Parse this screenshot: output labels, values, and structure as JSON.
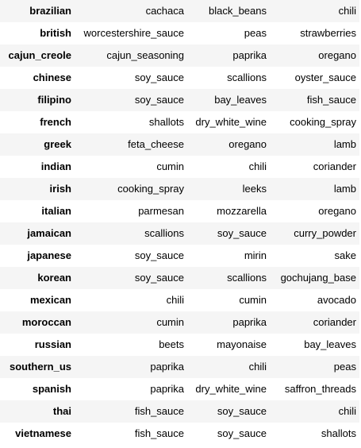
{
  "rows": [
    {
      "cuisine": "brazilian",
      "ingredients": [
        "cachaca",
        "black_beans",
        "chili"
      ]
    },
    {
      "cuisine": "british",
      "ingredients": [
        "worcestershire_sauce",
        "peas",
        "strawberries"
      ]
    },
    {
      "cuisine": "cajun_creole",
      "ingredients": [
        "cajun_seasoning",
        "paprika",
        "oregano"
      ]
    },
    {
      "cuisine": "chinese",
      "ingredients": [
        "soy_sauce",
        "scallions",
        "oyster_sauce"
      ]
    },
    {
      "cuisine": "filipino",
      "ingredients": [
        "soy_sauce",
        "bay_leaves",
        "fish_sauce"
      ]
    },
    {
      "cuisine": "french",
      "ingredients": [
        "shallots",
        "dry_white_wine",
        "cooking_spray"
      ]
    },
    {
      "cuisine": "greek",
      "ingredients": [
        "feta_cheese",
        "oregano",
        "lamb"
      ]
    },
    {
      "cuisine": "indian",
      "ingredients": [
        "cumin",
        "chili",
        "coriander"
      ]
    },
    {
      "cuisine": "irish",
      "ingredients": [
        "cooking_spray",
        "leeks",
        "lamb"
      ]
    },
    {
      "cuisine": "italian",
      "ingredients": [
        "parmesan",
        "mozzarella",
        "oregano"
      ]
    },
    {
      "cuisine": "jamaican",
      "ingredients": [
        "scallions",
        "soy_sauce",
        "curry_powder"
      ]
    },
    {
      "cuisine": "japanese",
      "ingredients": [
        "soy_sauce",
        "mirin",
        "sake"
      ]
    },
    {
      "cuisine": "korean",
      "ingredients": [
        "soy_sauce",
        "scallions",
        "gochujang_base"
      ]
    },
    {
      "cuisine": "mexican",
      "ingredients": [
        "chili",
        "cumin",
        "avocado"
      ]
    },
    {
      "cuisine": "moroccan",
      "ingredients": [
        "cumin",
        "paprika",
        "coriander"
      ]
    },
    {
      "cuisine": "russian",
      "ingredients": [
        "beets",
        "mayonaise",
        "bay_leaves"
      ]
    },
    {
      "cuisine": "southern_us",
      "ingredients": [
        "paprika",
        "chili",
        "peas"
      ]
    },
    {
      "cuisine": "spanish",
      "ingredients": [
        "paprika",
        "dry_white_wine",
        "saffron_threads"
      ]
    },
    {
      "cuisine": "thai",
      "ingredients": [
        "fish_sauce",
        "soy_sauce",
        "chili"
      ]
    },
    {
      "cuisine": "vietnamese",
      "ingredients": [
        "fish_sauce",
        "soy_sauce",
        "shallots"
      ]
    }
  ]
}
